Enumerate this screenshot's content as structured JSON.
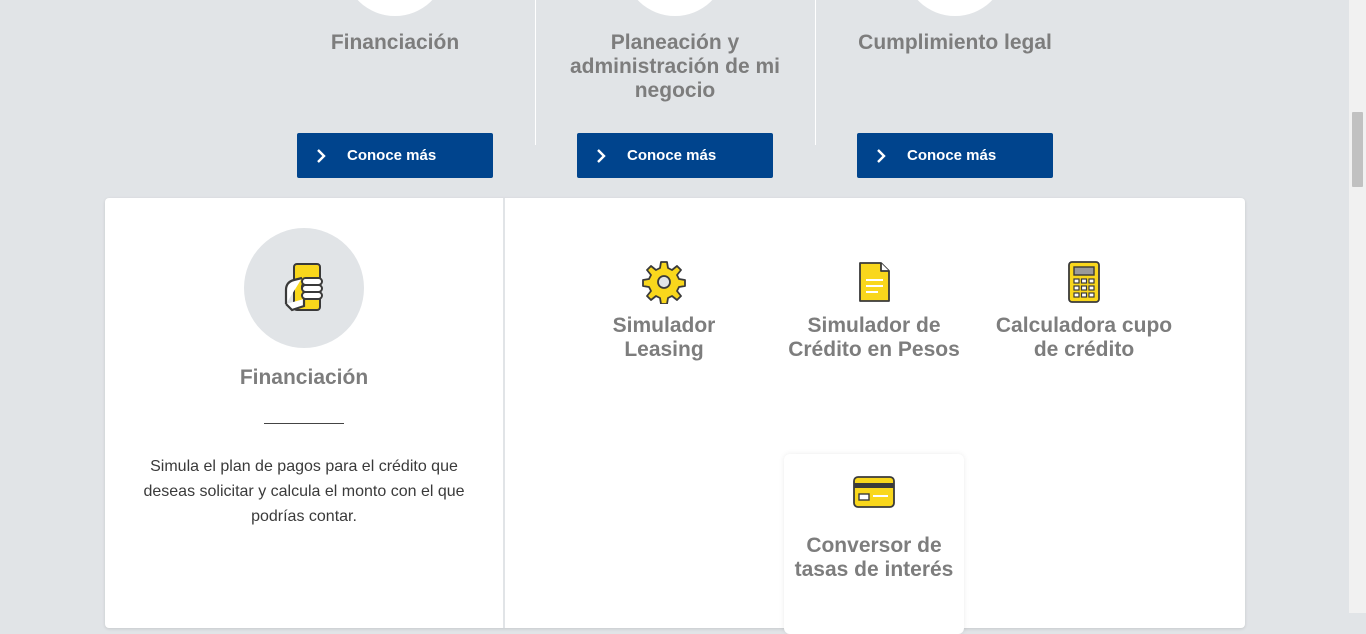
{
  "top_columns": [
    {
      "title": "Financiación",
      "button": "Conoce más"
    },
    {
      "title": "Planeación y administración de mi negocio",
      "button": "Conoce más"
    },
    {
      "title": "Cumplimiento legal",
      "button": "Conoce más"
    }
  ],
  "card": {
    "left": {
      "title": "Financiación",
      "description": "Simula el plan de pagos para el crédito que deseas solicitar y calcula el monto con el que podrías contar."
    },
    "tools": [
      {
        "label": "Simulador Leasing",
        "icon": "gear-icon"
      },
      {
        "label": "Simulador de Crédito en Pesos",
        "icon": "document-icon"
      },
      {
        "label": "Calculadora cupo de crédito",
        "icon": "calculator-icon"
      },
      {
        "label": "Conversor de tasas de interés",
        "icon": "card-icon"
      }
    ]
  },
  "colors": {
    "page_bg": "#e1e4e7",
    "button_bg": "#00448d",
    "icon_yellow": "#f9d71c",
    "heading_gray": "#7d7d7d"
  }
}
